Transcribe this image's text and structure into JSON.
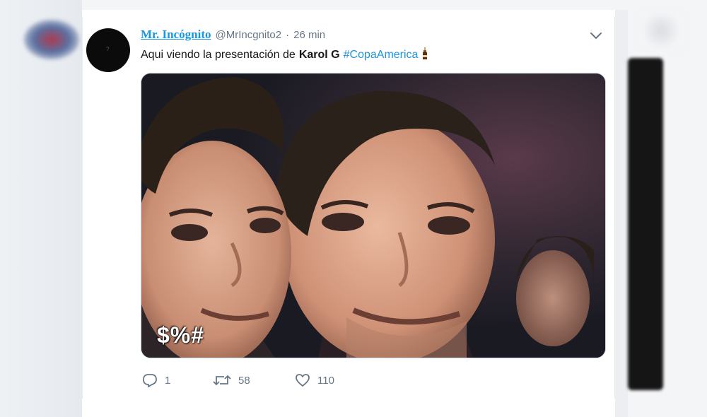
{
  "tweet": {
    "display_name": "Mr. Incógnito",
    "handle": "@MrIncgnito2",
    "separator": "·",
    "time": "26 min",
    "text": {
      "prefix": "Aqui viendo la presentación de",
      "mention": "Karol G",
      "hashtag": "#CopaAmerica"
    },
    "media_caption": "$%#",
    "stats": {
      "replies": "1",
      "retweets": "58",
      "likes": "110"
    }
  },
  "colors": {
    "link": "#1b95e0",
    "muted": "#657786",
    "text": "#14171a",
    "border": "#e6ecf0"
  },
  "icons": [
    "chevron-down-icon",
    "reply-icon",
    "retweet-icon",
    "like-icon",
    "bottle-emoji-icon"
  ]
}
